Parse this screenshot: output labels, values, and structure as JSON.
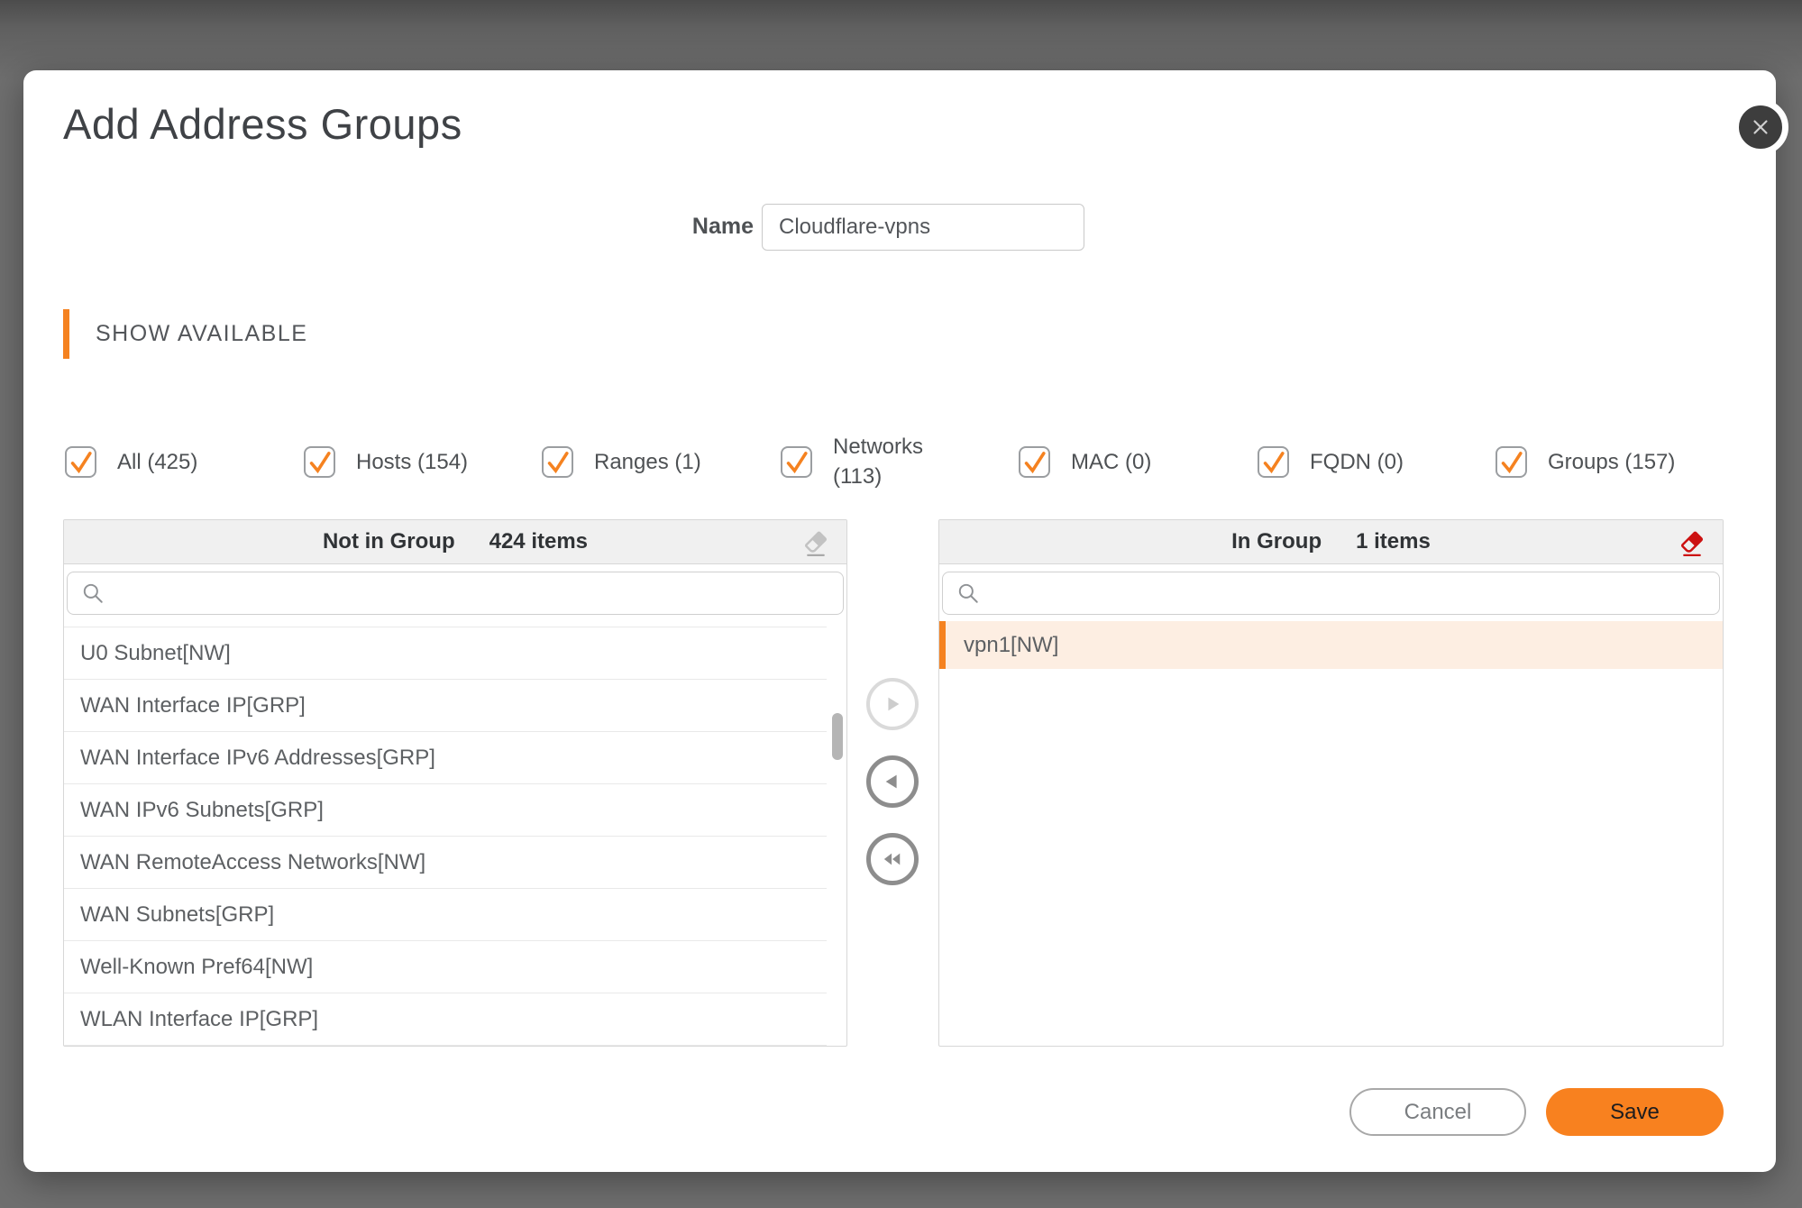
{
  "modal": {
    "title": "Add Address Groups",
    "name_field": {
      "label": "Name",
      "value": "Cloudflare-vpns"
    },
    "section_label": "SHOW AVAILABLE",
    "filters": [
      {
        "label": "All (425)",
        "checked": true
      },
      {
        "label": "Hosts (154)",
        "checked": true
      },
      {
        "label": "Ranges (1)",
        "checked": true
      },
      {
        "label": "Networks (113)",
        "checked": true
      },
      {
        "label": "MAC (0)",
        "checked": true
      },
      {
        "label": "FQDN (0)",
        "checked": true
      },
      {
        "label": "Groups (157)",
        "checked": true
      }
    ],
    "left_panel": {
      "title": "Not in Group",
      "count": "424 items",
      "search_placeholder": "",
      "search_value": "",
      "items": [
        "U0 Subnet[NW]",
        "WAN Interface IP[GRP]",
        "WAN Interface IPv6 Addresses[GRP]",
        "WAN IPv6 Subnets[GRP]",
        "WAN RemoteAccess Networks[NW]",
        "WAN Subnets[GRP]",
        "Well-Known Pref64[NW]",
        "WLAN Interface IP[GRP]"
      ]
    },
    "right_panel": {
      "title": "In Group",
      "count": "1 items",
      "search_placeholder": "",
      "search_value": "",
      "items": [
        "vpn1[NW]"
      ]
    },
    "buttons": {
      "cancel": "Cancel",
      "save": "Save"
    },
    "icons": {
      "close": "close-icon",
      "search": "search-icon",
      "eraser_disabled": "eraser-icon-gray",
      "eraser_active": "eraser-icon-red",
      "move_right": "arrow-right-circle-icon",
      "move_left": "arrow-left-circle-icon",
      "move_all_left": "double-arrow-left-circle-icon",
      "checkmark": "check-icon"
    },
    "colors": {
      "accent_orange": "#F58220",
      "save_button": "#F8811F",
      "eraser_red": "#CC1111",
      "selected_row_bg": "#FDEEE2",
      "overlay_gray": "#6E6E6E"
    }
  }
}
